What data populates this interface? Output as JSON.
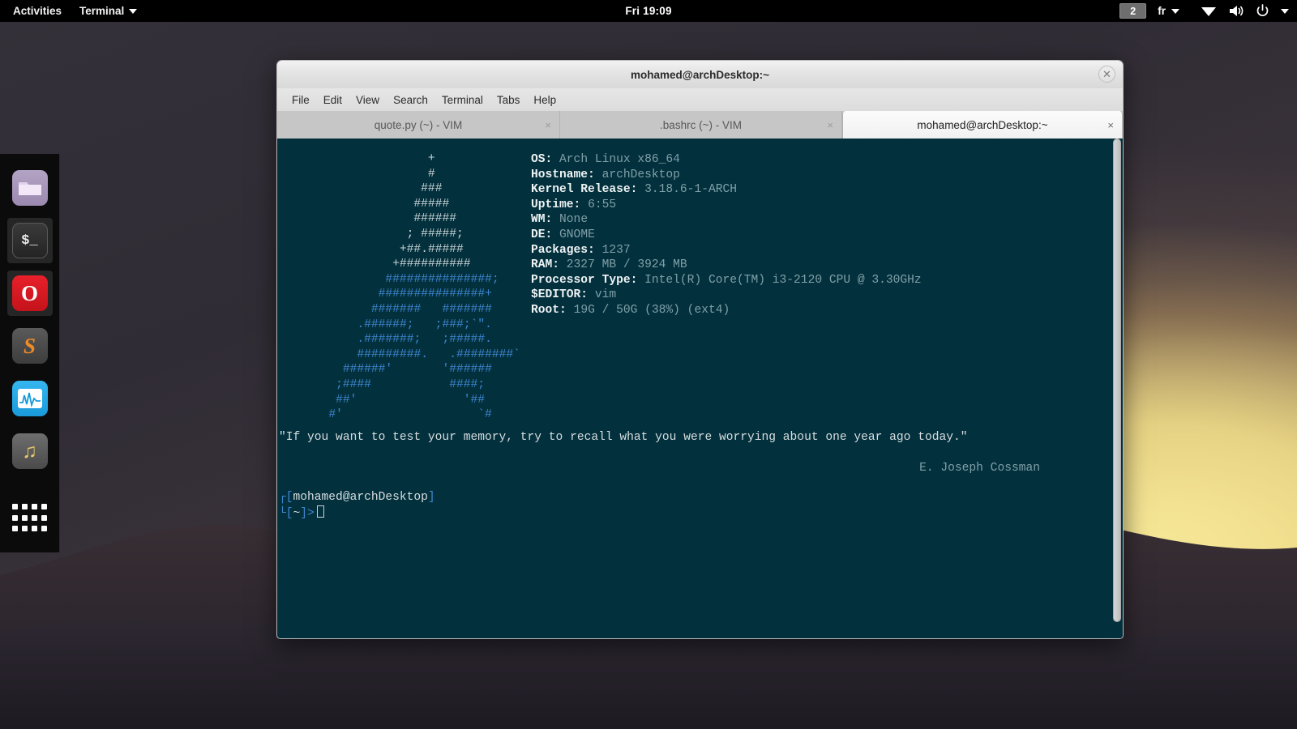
{
  "panel": {
    "activities": "Activities",
    "app_menu": "Terminal",
    "clock": "Fri 19:09",
    "workspace": "2",
    "language": "fr",
    "icons": [
      "wifi-icon",
      "volume-icon",
      "power-icon",
      "chevron-down-icon"
    ]
  },
  "dock": {
    "items": [
      {
        "name": "files",
        "glyph": ""
      },
      {
        "name": "terminal",
        "glyph": "$_"
      },
      {
        "name": "opera",
        "glyph": "O"
      },
      {
        "name": "sublime-text",
        "glyph": "S"
      },
      {
        "name": "system-monitor",
        "glyph": ""
      },
      {
        "name": "music-player",
        "glyph": "♫"
      },
      {
        "name": "show-applications",
        "glyph": ""
      }
    ]
  },
  "window": {
    "title": "mohamed@archDesktop:~",
    "close_label": "✕",
    "menu": [
      "File",
      "Edit",
      "View",
      "Search",
      "Terminal",
      "Tabs",
      "Help"
    ],
    "tabs": [
      {
        "label": "quote.py (~) - VIM",
        "close": "×",
        "active": false
      },
      {
        "label": ".bashrc (~) - VIM",
        "close": "×",
        "active": false
      },
      {
        "label": "mohamed@archDesktop:~",
        "close": "×",
        "active": true
      }
    ]
  },
  "terminal": {
    "ascii_art": [
      "                     +",
      "                     #",
      "                    ###",
      "                   #####",
      "                   ######",
      "                  ; #####;",
      "                 +##.#####",
      "                +##########",
      "               #####§§§####§##;",
      "              ###§§§§§§§§§§§#+",
      "             #§§§§§§   §§§§§§§",
      "           .§§§§§§;   ;§§§;`\".",
      "           .§§§§§§§;   ;§§§§§.",
      "           §§§§§§§§§.   .§§§§§§§§`",
      "         §§§§§§'       '§§§§§§",
      "        ;§§§§           §§§§;",
      "        §§'               '§§",
      "       #'                   `#"
    ],
    "sysinfo": [
      {
        "key": "OS:",
        "value": "Arch Linux x86_64"
      },
      {
        "key": "Hostname:",
        "value": "archDesktop"
      },
      {
        "key": "Kernel Release:",
        "value": "3.18.6-1-ARCH"
      },
      {
        "key": "Uptime:",
        "value": "6:55"
      },
      {
        "key": "WM:",
        "value": "None"
      },
      {
        "key": "DE:",
        "value": "GNOME"
      },
      {
        "key": "Packages:",
        "value": "1237"
      },
      {
        "key": "RAM:",
        "value": "2327 MB / 3924 MB"
      },
      {
        "key": "Processor Type:",
        "value": "Intel(R) Core(TM) i3-2120 CPU @ 3.30GHz"
      },
      {
        "key": "$EDITOR:",
        "value": "vim"
      },
      {
        "key": "Root:",
        "value": "19G / 50G (38%) (ext4)"
      }
    ],
    "quote": "\"If you want to test your memory, try to recall what you were worrying about one year ago today.\"",
    "quote_author": "E. Joseph Cossman",
    "prompt_line1_open": "┌[",
    "prompt_line1_text": "mohamed@archDesktop",
    "prompt_line1_close": "]",
    "prompt_line2_open": "└[",
    "prompt_line2_text": "~",
    "prompt_line2_close": "]>"
  },
  "colors": {
    "terminal_bg": "#03303d",
    "accent_blue": "#3d87d0",
    "panel_bg": "#000000",
    "value_text": "#7fa0a8"
  }
}
